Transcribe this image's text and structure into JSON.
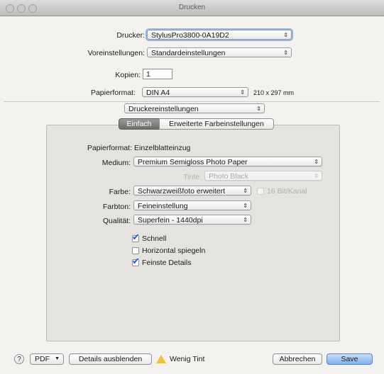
{
  "window": {
    "title": "Drucken"
  },
  "printer": {
    "label": "Drucker:",
    "value": "StylusPro3800-0A19D2"
  },
  "presets": {
    "label": "Voreinstellungen:",
    "value": "Standardeinstellungen"
  },
  "copies": {
    "label": "Kopien:",
    "value": "1"
  },
  "paper_size": {
    "label": "Papierformat:",
    "value": "DIN A4",
    "dimensions": "210 x 297 mm"
  },
  "section": {
    "value": "Druckereinstellungen"
  },
  "tabs": [
    {
      "label": "Einfach",
      "selected": true
    },
    {
      "label": "Erweiterte Farbeinstellungen",
      "selected": false
    }
  ],
  "settings": {
    "paper_source": {
      "label": "Papierformat:",
      "value": "Einzelblatteinzug"
    },
    "media": {
      "label": "Medium:",
      "value": "Premium Semigloss Photo Paper"
    },
    "ink": {
      "label": "Tinte:",
      "value": "Photo Black",
      "enabled": false
    },
    "color": {
      "label": "Farbe:",
      "value": "Schwarzweißfoto erweitert"
    },
    "bit16": {
      "label": "16 Bit/Kanal",
      "checked": false,
      "enabled": false
    },
    "tone": {
      "label": "Farbton:",
      "value": "Feineinstellung"
    },
    "quality": {
      "label": "Qualität:",
      "value": "Superfein - 1440dpi"
    },
    "options": [
      {
        "label": "Schnell",
        "checked": true
      },
      {
        "label": "Horizontal spiegeln",
        "checked": false
      },
      {
        "label": "Feinste Details",
        "checked": true
      }
    ]
  },
  "footer": {
    "help_label": "?",
    "pdf_label": "PDF",
    "details_label": "Details ausblenden",
    "warning_label": "Wenig Tint",
    "cancel_label": "Abbrechen",
    "save_label": "Save"
  },
  "colors": {
    "accent": "#1e5fbf",
    "default_button": "#7fb0ec",
    "warning": "#f3c12d"
  },
  "icons": {
    "popup": "up-down-arrows",
    "check": "checkmark",
    "warning": "warning-triangle"
  }
}
